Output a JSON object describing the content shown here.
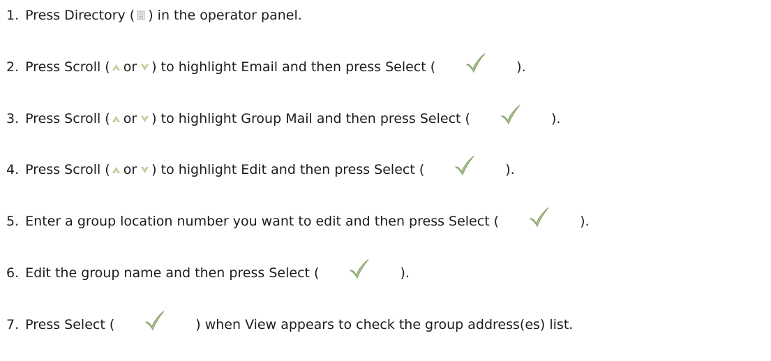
{
  "steps": [
    {
      "num": "1.",
      "parts": [
        {
          "type": "text",
          "value": "Press Directory ("
        },
        {
          "type": "icon",
          "value": "directory-icon"
        },
        {
          "type": "text",
          "value": ") in the operator panel."
        }
      ]
    },
    {
      "num": "2.",
      "parts": [
        {
          "type": "text",
          "value": "Press Scroll ("
        },
        {
          "type": "icon",
          "value": "scroll-up-icon"
        },
        {
          "type": "text",
          "value": "or"
        },
        {
          "type": "icon",
          "value": "scroll-down-icon"
        },
        {
          "type": "text",
          "value": ") to highlight Email and then press Select ("
        },
        {
          "type": "icon",
          "value": "checkmark-icon"
        },
        {
          "type": "text",
          "value": ")."
        }
      ]
    },
    {
      "num": "3.",
      "parts": [
        {
          "type": "text",
          "value": "Press Scroll ("
        },
        {
          "type": "icon",
          "value": "scroll-up-icon"
        },
        {
          "type": "text",
          "value": "or"
        },
        {
          "type": "icon",
          "value": "scroll-down-icon"
        },
        {
          "type": "text",
          "value": ") to highlight Group Mail and then press Select ("
        },
        {
          "type": "icon",
          "value": "checkmark-icon"
        },
        {
          "type": "text",
          "value": ")."
        }
      ]
    },
    {
      "num": "4.",
      "parts": [
        {
          "type": "text",
          "value": "Press Scroll ("
        },
        {
          "type": "icon",
          "value": "scroll-up-icon"
        },
        {
          "type": "text",
          "value": "or"
        },
        {
          "type": "icon",
          "value": "scroll-down-icon"
        },
        {
          "type": "text",
          "value": ") to highlight Edit and then press Select ("
        },
        {
          "type": "icon",
          "value": "checkmark-icon"
        },
        {
          "type": "text",
          "value": ")."
        }
      ]
    },
    {
      "num": "5.",
      "parts": [
        {
          "type": "text",
          "value": "Enter a group location number you want to edit and then press Select ("
        },
        {
          "type": "icon",
          "value": "checkmark-icon"
        },
        {
          "type": "text",
          "value": ")."
        }
      ]
    },
    {
      "num": "6.",
      "parts": [
        {
          "type": "text",
          "value": "Edit the group name and then press Select ("
        },
        {
          "type": "icon",
          "value": "checkmark-icon"
        },
        {
          "type": "text",
          "value": ")."
        }
      ]
    },
    {
      "num": "7.",
      "parts": [
        {
          "type": "text",
          "value": "Press Select ("
        },
        {
          "type": "icon",
          "value": "checkmark-icon"
        },
        {
          "type": "text",
          "value": ") when View appears to check the group address(es) list."
        }
      ]
    }
  ],
  "colors": {
    "text": "#1c1c1c",
    "scroll_icon": "#c9dca6",
    "scroll_icon_edge": "#9fb981",
    "check_light": "#d7e4c2",
    "check_mid": "#a9c08a",
    "check_dark": "#7e9964",
    "directory_icon": "#b9b9b9"
  }
}
